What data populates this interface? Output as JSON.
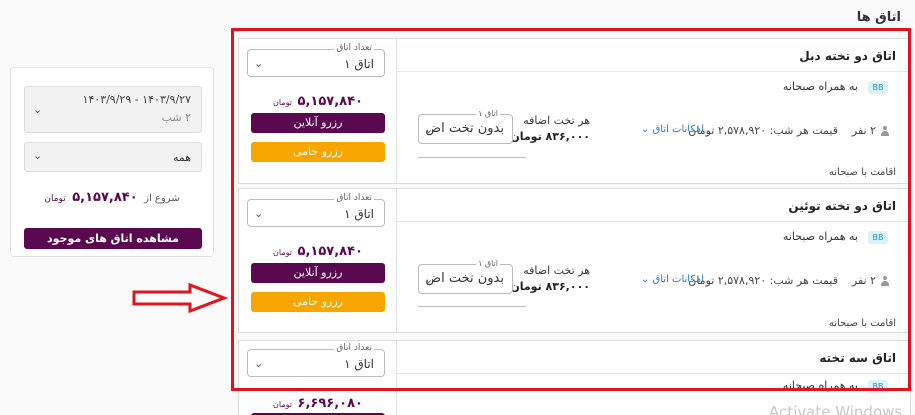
{
  "page": {
    "section_title": "اتاق ها"
  },
  "sidebar": {
    "date_range": "۱۴۰۳/۹/۲۷  -  ۱۴۰۳/۹/۲۹",
    "nights": "۲ شب",
    "filter_value": "همه",
    "starting_from_label": "شروع از",
    "starting_price": "۵,۱۵۷,۸۴۰",
    "currency": "تومان",
    "show_rooms_button": "مشاهده اتاق های موجود"
  },
  "rooms": [
    {
      "name": "اتاق دو تخته دبل",
      "board_badge": "BB",
      "board_text": "به همراه صبحانه",
      "persons": "۲ نفر",
      "night_price": "قیمت هر شب: ۲,۵۷۸,۹۲۰ تومان",
      "amenities_label": "امکانات اتاق",
      "extra_bed_title": "هر تخت اضافه",
      "extra_bed_price": "۸۳۶,۰۰۰ تومان",
      "bed_select_legend": "اتاق ۱",
      "bed_select_value": "بدون تخت اض",
      "stay_text": "اقامت با صبحانه",
      "rooms_count_legend": "تعداد اتاق",
      "rooms_count_value": "۱ اتاق",
      "price": "۵,۱۵۷,۸۴۰",
      "currency": "تومان",
      "online_button": "رزرو آنلاین",
      "hami_button": "رزرو حامی"
    },
    {
      "name": "اتاق دو تخته توئین",
      "board_badge": "BB",
      "board_text": "به همراه صبحانه",
      "persons": "۲ نفر",
      "night_price": "قیمت هر شب: ۲,۵۷۸,۹۲۰ تومان",
      "amenities_label": "امکانات اتاق",
      "extra_bed_title": "هر تخت اضافه",
      "extra_bed_price": "۸۳۶,۰۰۰ تومان",
      "bed_select_legend": "اتاق ۱",
      "bed_select_value": "بدون تخت اض",
      "stay_text": "اقامت با صبحانه",
      "rooms_count_legend": "تعداد اتاق",
      "rooms_count_value": "۱ اتاق",
      "price": "۵,۱۵۷,۸۴۰",
      "currency": "تومان",
      "online_button": "رزرو آنلاین",
      "hami_button": "رزرو حامی"
    },
    {
      "name": "اتاق سه تخته",
      "board_badge": "BB",
      "board_text": "به همراه صبحانه",
      "rooms_count_legend": "تعداد اتاق",
      "rooms_count_value": "۱ اتاق",
      "price": "۶,۶۹۶,۰۸۰",
      "currency": "تومان"
    }
  ],
  "watermark": "Activate Windows",
  "colors": {
    "highlight_frame": "#e0141e",
    "primary": "#5a0850",
    "secondary_button": "#f7a600",
    "link": "#2a7bc4"
  }
}
